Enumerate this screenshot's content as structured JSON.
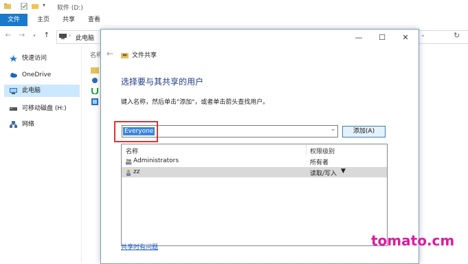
{
  "explorer": {
    "title": "软件 (D:)",
    "tabs": [
      "文件",
      "主页",
      "共享",
      "查看"
    ],
    "address": "此电脑",
    "nav_items": [
      {
        "label": "快速访问",
        "icon": "star-icon"
      },
      {
        "label": "OneDrive",
        "icon": "cloud-icon"
      },
      {
        "label": "此电脑",
        "icon": "computer-icon",
        "selected": true
      },
      {
        "label": "可移动磁盘 (H:)",
        "icon": "drive-icon"
      },
      {
        "label": "网络",
        "icon": "network-icon"
      }
    ],
    "column_header": "名称"
  },
  "dialog": {
    "window_controls": {
      "minimize": "—",
      "maximize": "☐",
      "close": "✕"
    },
    "app_title": "文件共享",
    "heading": "选择要与其共享的用户",
    "instruction": "键入名称，然后单击\"添加\"，或者单击箭头查找用户。",
    "name_input_value": "Everyone",
    "add_button": "添加(A)",
    "list": {
      "headers": {
        "name": "名称",
        "level": "权限级别"
      },
      "rows": [
        {
          "name": "Administrators",
          "level": "所有者"
        },
        {
          "name": "zz",
          "level": "读取/写入",
          "dropdown": "▼"
        }
      ]
    },
    "help_link": "共享时有问题"
  },
  "watermark": "tomato.cm",
  "colors": {
    "accent": "#1979ca",
    "highlight_red": "#d93434",
    "watermark_magenta": "#e01aa3",
    "selection_blue": "#3b85d8"
  }
}
